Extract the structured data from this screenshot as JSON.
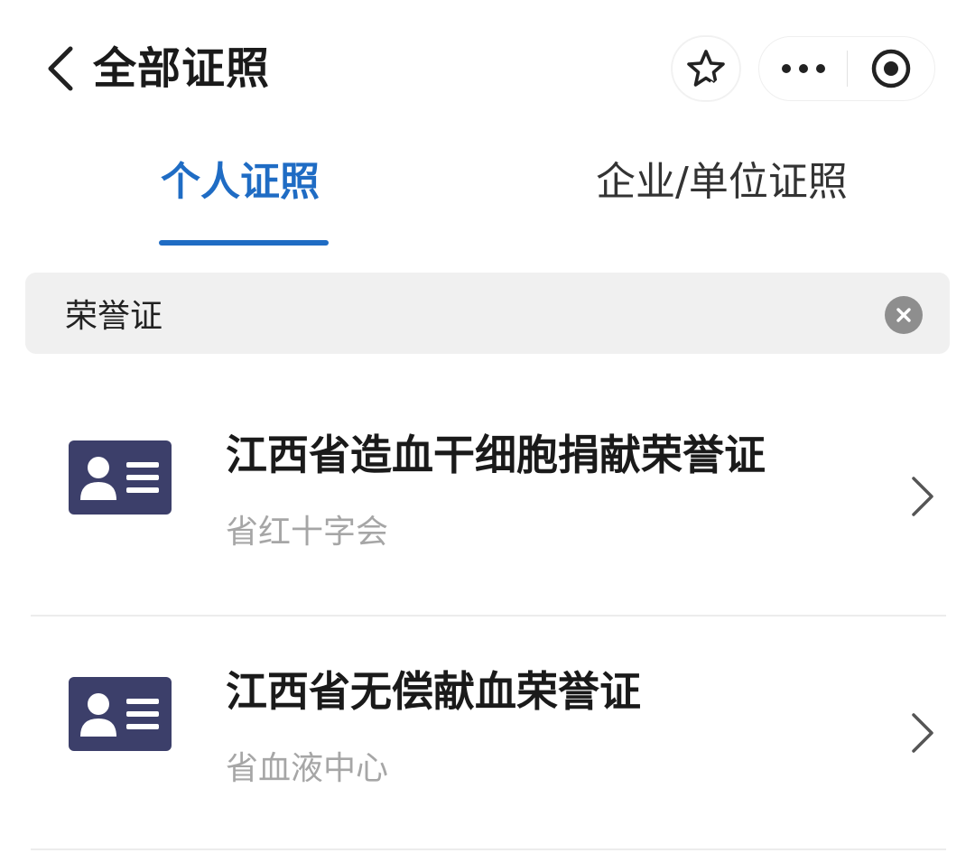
{
  "header": {
    "title": "全部证照",
    "back_icon": "chevron-left-icon",
    "star_icon": "star-icon",
    "more_icon": "more-dots-icon",
    "close_icon": "record-circle-icon"
  },
  "tabs": [
    {
      "label": "个人证照",
      "active": true
    },
    {
      "label": "企业/单位证照",
      "active": false
    }
  ],
  "search": {
    "value": "荣誉证",
    "clear_icon": "clear-icon"
  },
  "results": [
    {
      "title": "江西省造血干细胞捐献荣誉证",
      "issuer": "省红十字会",
      "icon": "id-card-icon"
    },
    {
      "title": "江西省无偿献血荣誉证",
      "issuer": "省血液中心",
      "icon": "id-card-icon"
    }
  ],
  "colors": {
    "accent": "#1f6cc4",
    "icon_bg": "#3c3f6a",
    "muted_text": "#a6a6a6",
    "search_bg": "#f0f0f0"
  }
}
